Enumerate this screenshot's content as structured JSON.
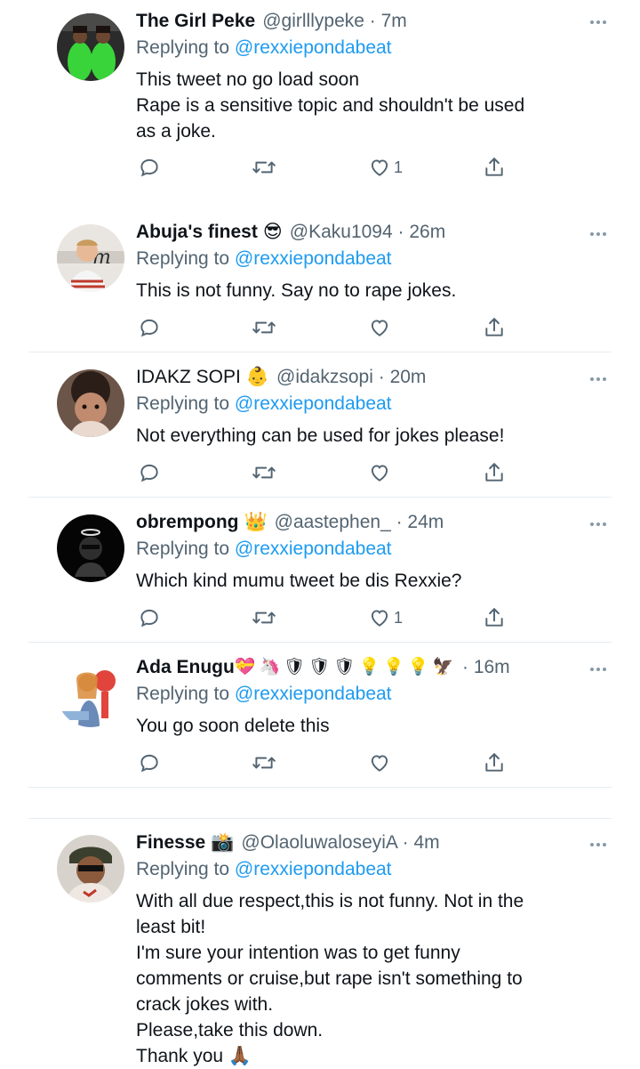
{
  "reply_prefix": "Replying to",
  "reply_target": "@rexxiepondabeat",
  "dot": "·",
  "tweets": [
    {
      "name": "The Girl Peke",
      "handle": "@girlllypeke",
      "time": "7m",
      "lines": [
        "This tweet no go load soon",
        "Rape is a sensitive topic and shouldn't be used",
        "as a joke."
      ],
      "likes": "1"
    },
    {
      "name": "Abuja's finest",
      "emoji": "😎",
      "handle": "@Kaku1094",
      "time": "26m",
      "lines": [
        "This is not funny. Say no to rape jokes."
      ],
      "likes": ""
    },
    {
      "name": "IDAKZ SOPI",
      "emoji": "👶",
      "handle": "@idakzsopi",
      "time": "20m",
      "lines": [
        "Not everything can be used for jokes please!"
      ],
      "likes": ""
    },
    {
      "name": "obrempong",
      "emoji": "👑",
      "handle": "@aastephen_",
      "time": "24m",
      "lines": [
        "Which kind mumu tweet be dis Rexxie?"
      ],
      "likes": "1"
    },
    {
      "name": "Ada Enugu",
      "emoji": "💝🦄🛡🛡🛡💡💡💡🦅",
      "handle": "",
      "time": "16m",
      "lines": [
        "You go soon delete this"
      ],
      "likes": ""
    },
    {
      "name": "Finesse",
      "emoji": "📸",
      "handle": "@OlaoluwaloseyiA",
      "time": "4m",
      "lines": [
        "With all due respect,this is not funny. Not in the",
        "least bit!",
        "I'm sure your intention was to get funny",
        "comments or cruise,but rape isn't something to",
        "crack jokes with.",
        "Please,take this down.",
        "Thank you 🙏🏾"
      ],
      "likes": ""
    }
  ],
  "icons": {
    "reply": "reply-icon",
    "retweet": "retweet-icon",
    "like": "like-icon",
    "share": "share-icon",
    "more": "more-icon"
  },
  "colors": {
    "link": "#1d9bf0",
    "muted": "#536471",
    "divider": "#e6ecf0"
  }
}
